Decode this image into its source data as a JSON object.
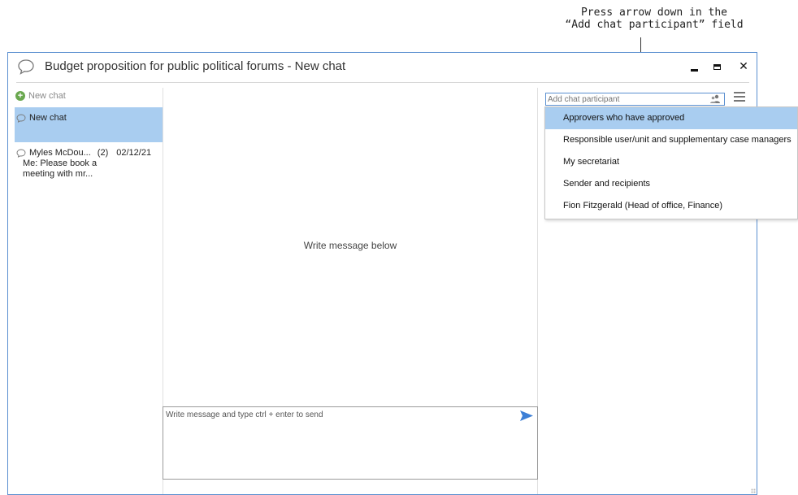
{
  "annotation": {
    "line1": "Press arrow down in the",
    "line2": "“Add chat participant” field"
  },
  "window": {
    "title": "Budget proposition for public political forums - New chat",
    "close_glyph": "✕"
  },
  "sidebar": {
    "new_chat_label": "New chat",
    "active_chat": {
      "label": "New chat"
    },
    "chats": [
      {
        "name": "Myles McDou...",
        "count": "(2)",
        "date": "02/12/21",
        "preview_line1": "Me: Please book a",
        "preview_line2": "meeting with mr..."
      }
    ]
  },
  "main": {
    "placeholder": "Write message below",
    "compose_placeholder": "Write message and type ctrl + enter to send"
  },
  "participant": {
    "placeholder": "Add chat participant",
    "options": [
      "Approvers who have approved",
      "Responsible user/unit and supplementary case managers",
      "My secretariat",
      "Sender and recipients",
      "Fion Fitzgerald (Head of office, Finance)"
    ],
    "selected_index": 0
  },
  "colors": {
    "accent_border": "#5a8fd0",
    "selection": "#a9cdf0",
    "send_arrow": "#3d7fd6"
  },
  "icons": [
    "chat-bubble-icon",
    "plus-icon",
    "people-icon",
    "menu-icon",
    "send-icon",
    "minimize-icon",
    "maximize-icon",
    "close-icon"
  ]
}
